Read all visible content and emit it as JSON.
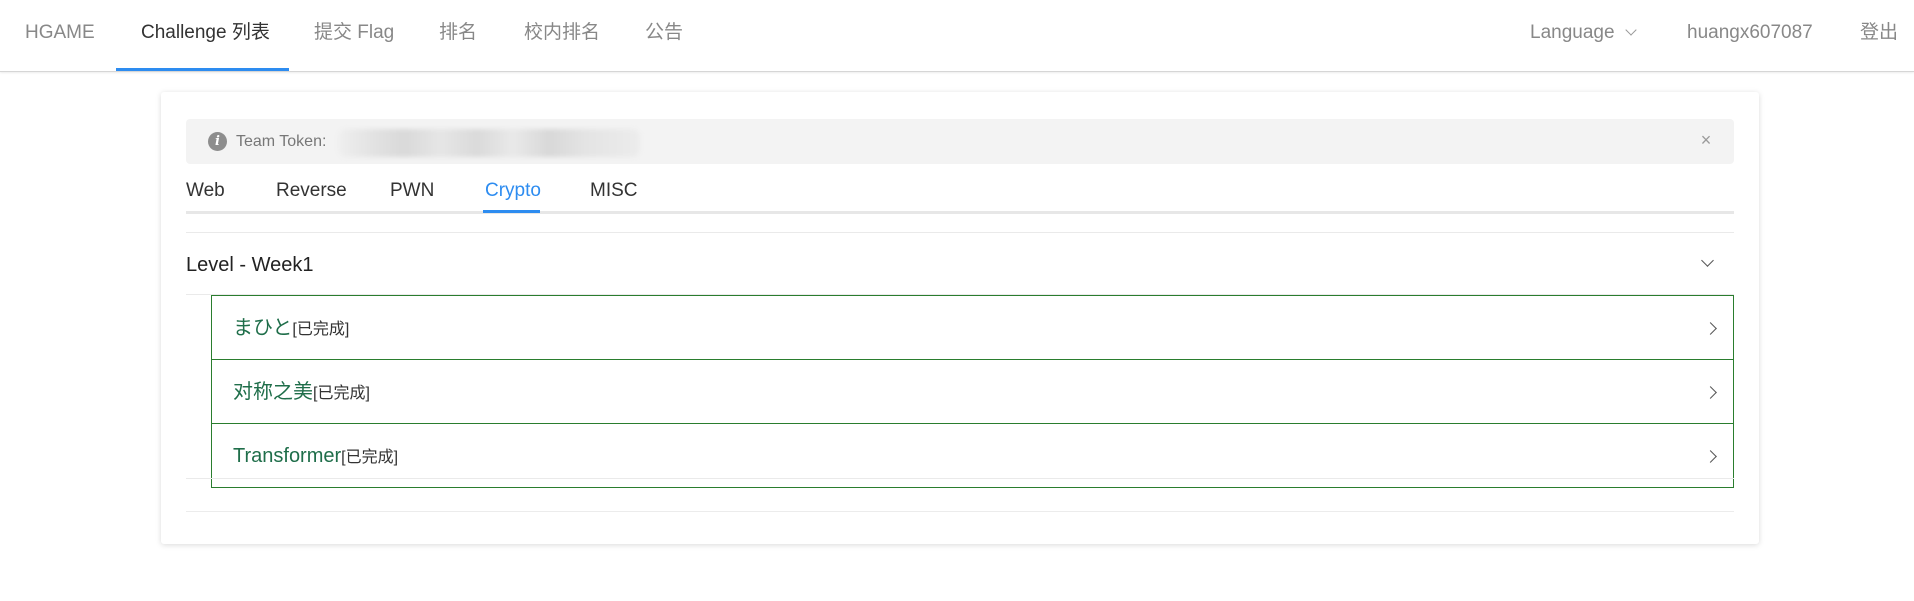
{
  "nav": {
    "brand": "HGAME",
    "items": [
      {
        "label": "Challenge 列表"
      },
      {
        "label": "提交 Flag"
      },
      {
        "label": "排名"
      },
      {
        "label": "校内排名"
      },
      {
        "label": "公告"
      }
    ],
    "language": "Language",
    "username": "huangx607087",
    "logout": "登出"
  },
  "alert": {
    "label": "Team Token:",
    "close": "×",
    "icon": "info-icon"
  },
  "tabs": [
    {
      "label": "Web"
    },
    {
      "label": "Reverse"
    },
    {
      "label": "PWN"
    },
    {
      "label": "Crypto"
    },
    {
      "label": "MISC"
    }
  ],
  "active_tab": "Crypto",
  "level": {
    "title": "Level - Week1",
    "challenges": [
      {
        "name": "まひと",
        "status": "[已完成]"
      },
      {
        "name": "对称之美",
        "status": "[已完成]"
      },
      {
        "name": "Transformer",
        "status": "[已完成]"
      }
    ]
  },
  "colors": {
    "accent": "#2d8cf0",
    "solved_border": "#2a7d2e",
    "solved_text": "#1f6e4a"
  }
}
